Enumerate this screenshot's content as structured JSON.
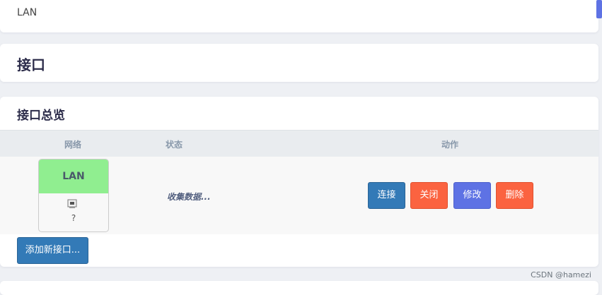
{
  "breadcrumb": {
    "current": "LAN"
  },
  "page": {
    "title": "接口"
  },
  "overview": {
    "title": "接口总览",
    "columns": [
      "网络",
      "状态",
      "动作"
    ],
    "interfaces": [
      {
        "name": "LAN",
        "icon": "ethernet-port-icon",
        "device": "?",
        "status": "收集数据...",
        "actions": {
          "connect": "连接",
          "stop": "关闭",
          "edit": "修改",
          "delete": "删除"
        }
      }
    ],
    "add_button": "添加新接口..."
  },
  "watermark": "CSDN @hamezi",
  "colors": {
    "background": "#eef0f4",
    "lan_zone": "#90ee90",
    "primary_button": "#337ab7",
    "danger_button": "#fb6340",
    "edit_button": "#5e72e4"
  }
}
